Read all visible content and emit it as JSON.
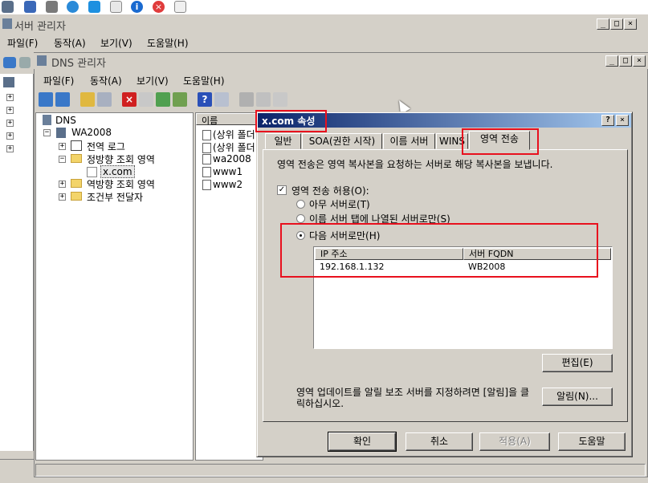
{
  "server_manager": {
    "title": "서버 관리자",
    "menu": [
      "파일(F)",
      "동작(A)",
      "보기(V)",
      "도움말(H)"
    ]
  },
  "dns_manager": {
    "title": "DNS 관리자",
    "menu": [
      "파일(F)",
      "동작(A)",
      "보기(V)",
      "도움말(H)"
    ],
    "tree": {
      "root": "DNS",
      "server": "WA2008",
      "items": [
        "전역 로그",
        "정방향 조회 영역",
        "x.com",
        "역방향 조회 영역",
        "조건부 전달자"
      ]
    },
    "list": {
      "header": "이름",
      "rows": [
        "(상위 폴더",
        "(상위 폴더",
        "wa2008",
        "www1",
        "www2"
      ]
    }
  },
  "dialog": {
    "title": "x.com 속성",
    "help_btn": "?",
    "close_btn": "×",
    "tabs": [
      "일반",
      "SOA(권한 시작)",
      "이름 서버",
      "WINS",
      "영역 전송"
    ],
    "description": "영역 전송은 영역 복사본을 요청하는 서버로 해당 복사본을 보냅니다.",
    "allow_checkbox": "영역 전송 허용(O):",
    "radio_any": "아무 서버로(T)",
    "radio_ns_tab": "이름 서버 탭에 나열된 서버로만(S)",
    "radio_following": "다음 서버로만(H)",
    "columns": [
      "IP 주소",
      "서버 FQDN"
    ],
    "servers": [
      {
        "ip": "192.168.1.132",
        "fqdn": "WB2008"
      }
    ],
    "edit_btn": "편집(E)",
    "notify_text": "영역 업데이트를 알릴 보조 서버를 지정하려면 [알림]을 클릭하십시오.",
    "notify_btn": "알림(N)...",
    "ok_btn": "확인",
    "cancel_btn": "취소",
    "apply_btn": "적용(A)",
    "help_button": "도움말"
  },
  "colors": {
    "highlight": "#e8101e",
    "title_active": "#0a246a"
  }
}
